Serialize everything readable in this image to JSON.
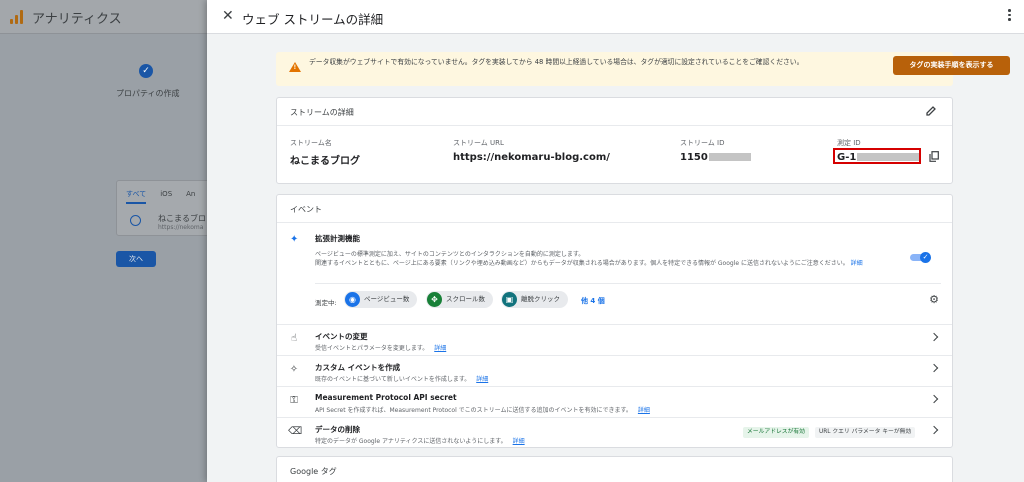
{
  "background": {
    "app_title": "アナリティクス",
    "step_label": "プロパティの作成",
    "tabs": [
      "すべて",
      "iOS",
      "An"
    ],
    "stream_item": {
      "name": "ねこまるブロ",
      "url": "https://nekoma"
    },
    "next_button": "次へ"
  },
  "drawer": {
    "title": "ウェブ ストリームの詳細"
  },
  "banner": {
    "text": "データ収集がウェブサイトで有効になっていません。タグを実装してから 48 時間以上経過している場合は、タグが適切に設定されていることをご確認ください。",
    "button": "タグの実装手順を表示する"
  },
  "stream_details": {
    "title": "ストリームの詳細",
    "fields": [
      {
        "label": "ストリーム名",
        "value": "ねこまるブログ"
      },
      {
        "label": "ストリーム URL",
        "value": "https://nekomaru-blog.com/"
      },
      {
        "label": "ストリーム ID",
        "value": "1150"
      },
      {
        "label": "測定 ID",
        "value": "G-1"
      }
    ]
  },
  "events": {
    "title": "イベント",
    "enhanced": {
      "title": "拡張計測機能",
      "desc_line1": "ページビューの標準測定に加え、サイトのコンテンツとのインタラクションを自動的に測定します。",
      "desc_line2": "関連するイベントとともに、ページ上にある要素（リンクや埋め込み動画など）からもデータが収集される場合があります。個人を特定できる情報が Google に送信されないようにご注意ください。",
      "link": "詳細",
      "measuring_label": "測定中:",
      "chips": [
        {
          "label": "ページビュー数",
          "color": "#1a73e8",
          "icon": "eye-icon"
        },
        {
          "label": "スクロール数",
          "color": "#188038",
          "icon": "scroll-icon"
        },
        {
          "label": "離脱クリック",
          "color": "#12737d",
          "icon": "click-icon"
        }
      ],
      "more": "他 4 個",
      "enabled": true
    },
    "rows": [
      {
        "title": "イベントの変更",
        "desc": "受信イベントとパラメータを変更します。",
        "link": "詳細",
        "icon": "touch-icon"
      },
      {
        "title": "カスタム イベントを作成",
        "desc": "既存のイベントに基づいて新しいイベントを作成します。",
        "link": "詳細",
        "icon": "magic-icon"
      },
      {
        "title": "Measurement Protocol API secret",
        "desc": "API Secret を作成すれば、Measurement Protocol でこのストリームに送信する追加のイベントを有効にできます。",
        "link": "詳細",
        "icon": "key-icon"
      },
      {
        "title": "データの削除",
        "desc": "特定のデータが Google アナリティクスに送信されないようにします。",
        "link": "詳細",
        "icon": "eraser-icon"
      }
    ],
    "badges": [
      "メールアドレスが有効",
      "URL クエリ パラメータ キーが無効"
    ]
  },
  "google_tag": {
    "title": "Google タグ"
  }
}
